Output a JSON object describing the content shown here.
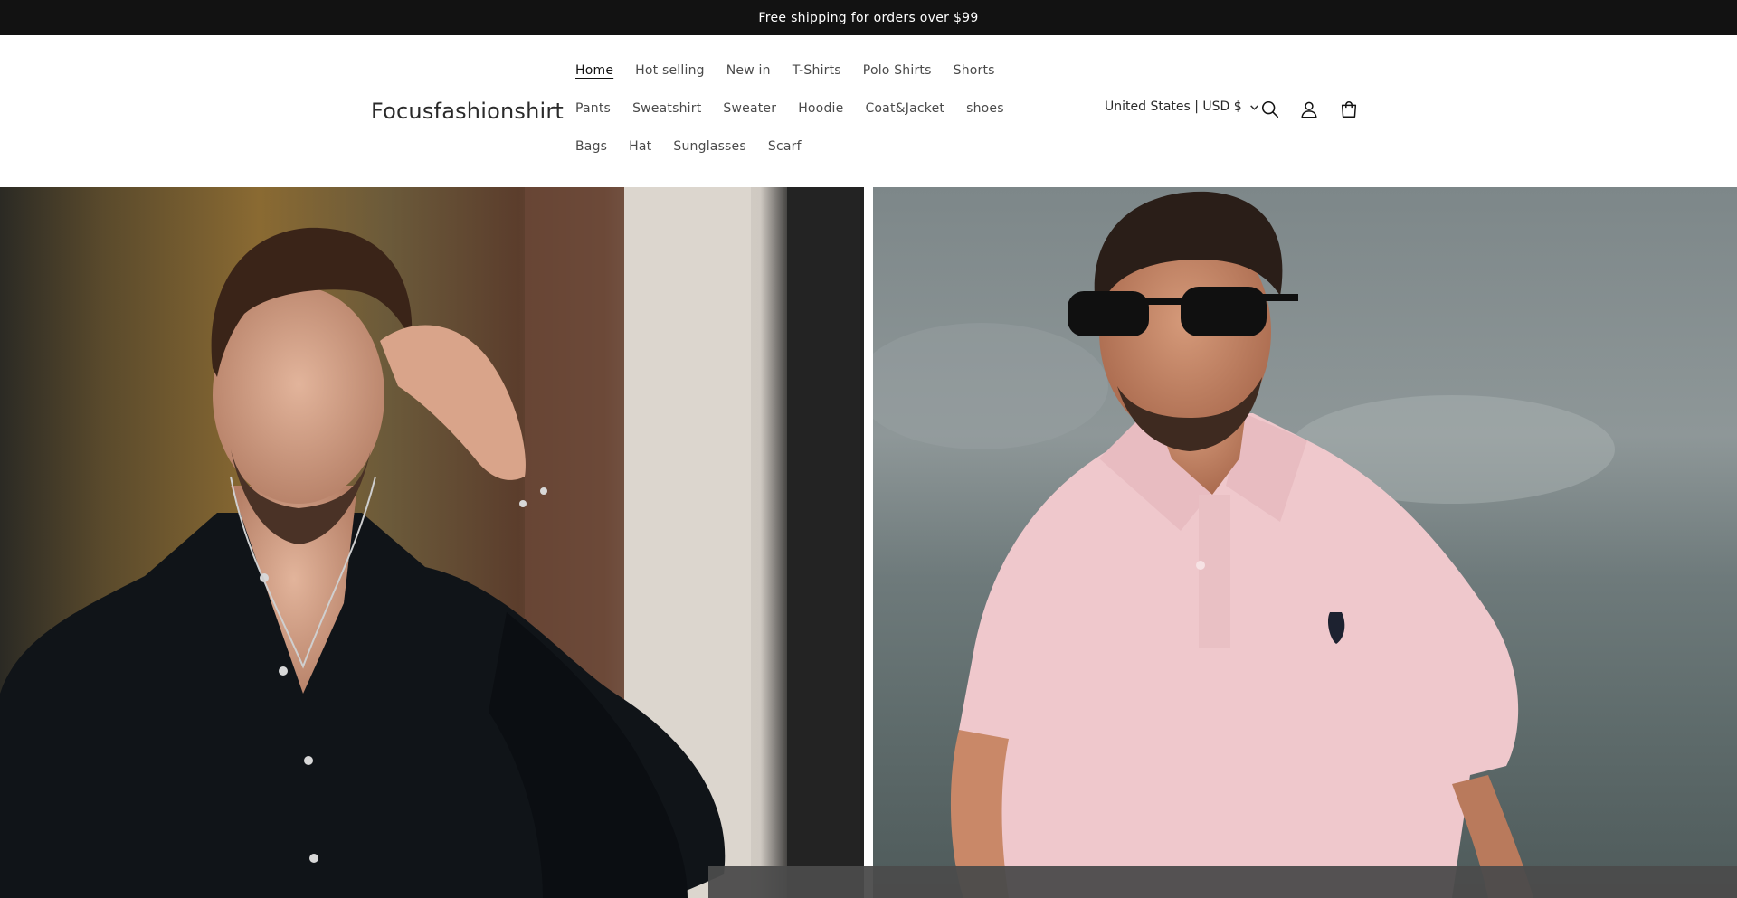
{
  "announcement": {
    "text": "Free shipping for orders over $99"
  },
  "header": {
    "logo": "Focusfashionshirt",
    "nav": [
      {
        "label": "Home",
        "active": true
      },
      {
        "label": "Hot selling"
      },
      {
        "label": "New in"
      },
      {
        "label": "T-Shirts"
      },
      {
        "label": "Polo Shirts"
      },
      {
        "label": "Shorts"
      },
      {
        "label": "Pants"
      },
      {
        "label": "Sweatshirt"
      },
      {
        "label": "Sweater"
      },
      {
        "label": "Hoodie"
      },
      {
        "label": "Coat&Jacket"
      },
      {
        "label": "shoes"
      },
      {
        "label": "Bags"
      },
      {
        "label": "Hat"
      },
      {
        "label": "Sunglasses"
      },
      {
        "label": "Scarf"
      }
    ],
    "region": "United States | USD $",
    "icons": [
      "search-icon",
      "account-icon",
      "cart-icon"
    ]
  },
  "hero": {
    "left_image": "man-in-black-shirt-photo",
    "right_image": "man-in-pink-polo-photo"
  },
  "colors": {
    "announcement_bg": "#121212",
    "text": "#121212",
    "overlay": "#4b4b4b"
  }
}
